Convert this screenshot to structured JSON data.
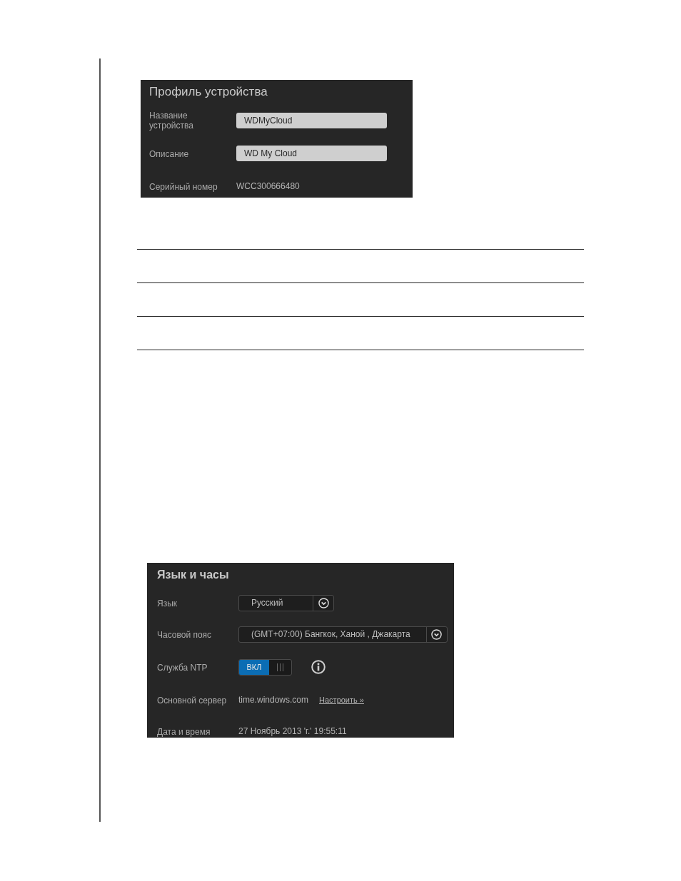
{
  "device_profile": {
    "title": "Профиль устройства",
    "fields": [
      {
        "kind": "input",
        "label": "Название устройства",
        "value": "WDMyCloud"
      },
      {
        "kind": "input",
        "label": "Описание",
        "value": "WD My Cloud"
      },
      {
        "kind": "text",
        "label": "Серийный номер",
        "value": "WCC300666480"
      }
    ]
  },
  "language_and_clock": {
    "title": "Язык и часы",
    "fields": [
      {
        "kind": "select",
        "label": "Язык",
        "value": "Русский"
      },
      {
        "kind": "select",
        "label": "Часовой пояс",
        "value": "(GMT+07:00) Бангкок, Ханой , Джакарта"
      },
      {
        "kind": "toggle",
        "label": "Служба NTP",
        "on": true,
        "state_label": "ВКЛ"
      },
      {
        "kind": "text_link",
        "label": "Основной сервер",
        "value": "time.windows.com",
        "link": "Настроить »"
      },
      {
        "kind": "text",
        "label": "Дата и время",
        "value": "27 Ноябрь 2013 'г.' 19:55:11"
      }
    ]
  }
}
